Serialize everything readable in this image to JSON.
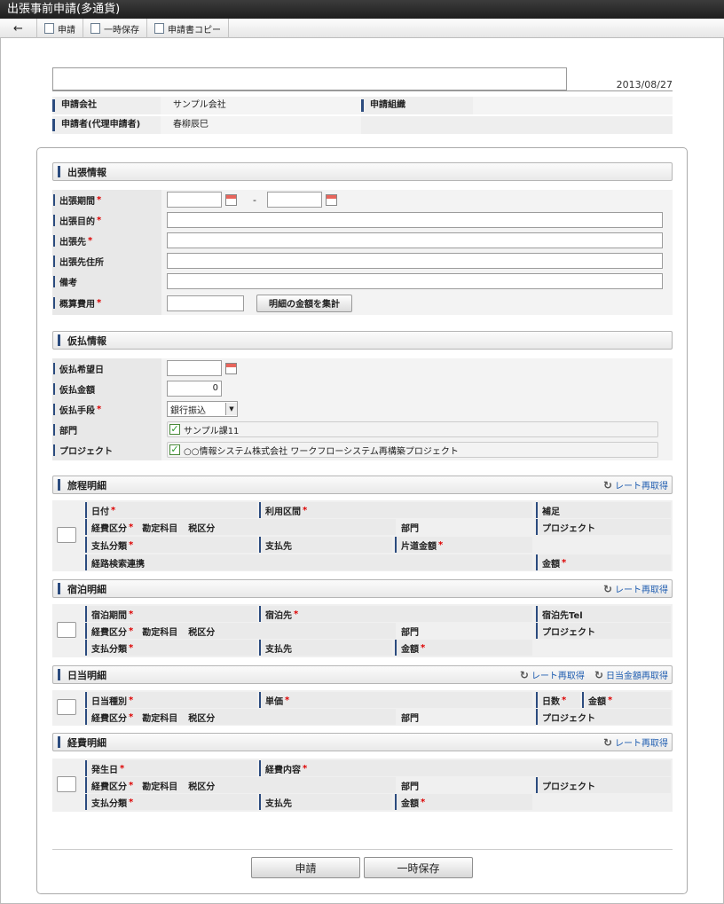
{
  "window": {
    "title": "出張事前申請(多通貨)"
  },
  "toolbar": {
    "back": "←",
    "apply": "申請",
    "save": "一時保存",
    "copy": "申請書コピー"
  },
  "header": {
    "subject_value": "",
    "date": "2013/08/27",
    "company_label": "申請会社",
    "company_value": "サンプル会社",
    "org_label": "申請組織",
    "org_value": "",
    "applicant_label": "申請者(代理申請者)",
    "applicant_value": "春柳辰巳"
  },
  "trip": {
    "title": "出張情報",
    "period_label": "出張期間",
    "period_sep": "-",
    "purpose_label": "出張目的",
    "destination_label": "出張先",
    "address_label": "出張先住所",
    "note_label": "備考",
    "estimate_label": "概算費用",
    "sum_button": "明細の金額を集計",
    "req": "*"
  },
  "advance": {
    "title": "仮払情報",
    "date_label": "仮払希望日",
    "amount_label": "仮払金額",
    "amount_value": "0",
    "method_label": "仮払手段",
    "method_value": "銀行振込",
    "dept_label": "部門",
    "dept_value": "サンプル課11",
    "project_label": "プロジェクト",
    "project_value": "○○情報システム株式会社 ワークフローシステム再構築プロジェクト"
  },
  "itinerary": {
    "title": "旅程明細",
    "rate": "レート再取得",
    "date": "日付",
    "route": "利用区間",
    "supplement": "補足",
    "expense_type": "経費区分",
    "account": "勘定科目",
    "tax": "税区分",
    "dept": "部門",
    "project": "プロジェクト",
    "pay_class": "支払分類",
    "payee": "支払先",
    "one_way": "片道金額",
    "route_search": "経路検索連携",
    "amount": "金額"
  },
  "lodging": {
    "title": "宿泊明細",
    "rate": "レート再取得",
    "period": "宿泊期間",
    "place": "宿泊先",
    "tel": "宿泊先Tel",
    "expense_type": "経費区分",
    "account": "勘定科目",
    "tax": "税区分",
    "dept": "部門",
    "project": "プロジェクト",
    "pay_class": "支払分類",
    "payee": "支払先",
    "amount": "金額"
  },
  "daily": {
    "title": "日当明細",
    "rate": "レート再取得",
    "recalc": "日当金額再取得",
    "kind": "日当種別",
    "unit": "単価",
    "days": "日数",
    "amount": "金額",
    "expense_type": "経費区分",
    "account": "勘定科目",
    "tax": "税区分",
    "dept": "部門",
    "project": "プロジェクト"
  },
  "expense": {
    "title": "経費明細",
    "rate": "レート再取得",
    "occur": "発生日",
    "content": "経費内容",
    "expense_type": "経費区分",
    "account": "勘定科目",
    "tax": "税区分",
    "dept": "部門",
    "project": "プロジェクト",
    "pay_class": "支払分類",
    "payee": "支払先",
    "amount": "金額"
  },
  "footer": {
    "apply": "申請",
    "save": "一時保存"
  },
  "colors": {
    "accent": "#2b4b7e",
    "link": "#1f5db0",
    "required": "#dd0000",
    "titlebar": "#2a2a2a"
  }
}
